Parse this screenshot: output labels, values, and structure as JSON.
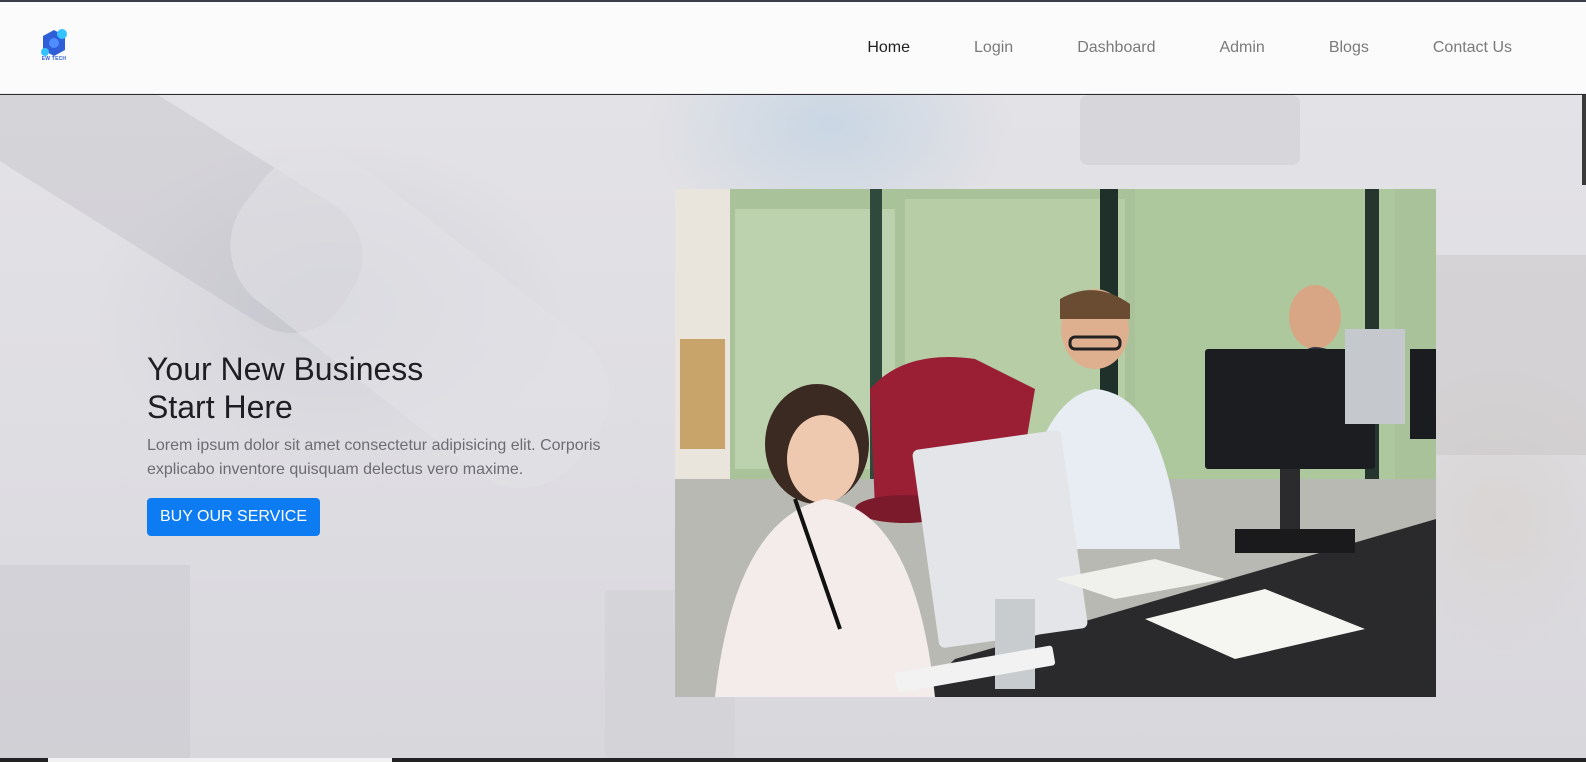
{
  "brand": {
    "logo_text": "EW TECH",
    "logo_icon": "hexagon-molecule-logo-icon",
    "colors": {
      "primary": "#2f5fd8",
      "secondary": "#35c3ff"
    }
  },
  "nav": {
    "items": [
      {
        "label": "Home",
        "active": true
      },
      {
        "label": "Login",
        "active": false
      },
      {
        "label": "Dashboard",
        "active": false
      },
      {
        "label": "Admin",
        "active": false
      },
      {
        "label": "Blogs",
        "active": false
      },
      {
        "label": "Contact Us",
        "active": false
      }
    ]
  },
  "hero": {
    "title_line1": "Your New Business",
    "title_line2": "Start Here",
    "description": "Lorem ipsum dolor sit amet consectetur adipisicing elit. Corporis explicabo inventore quisquam delectus vero maxime.",
    "cta_label": "BUY OUR SERVICE",
    "cta_color": "#0d7cf2"
  }
}
